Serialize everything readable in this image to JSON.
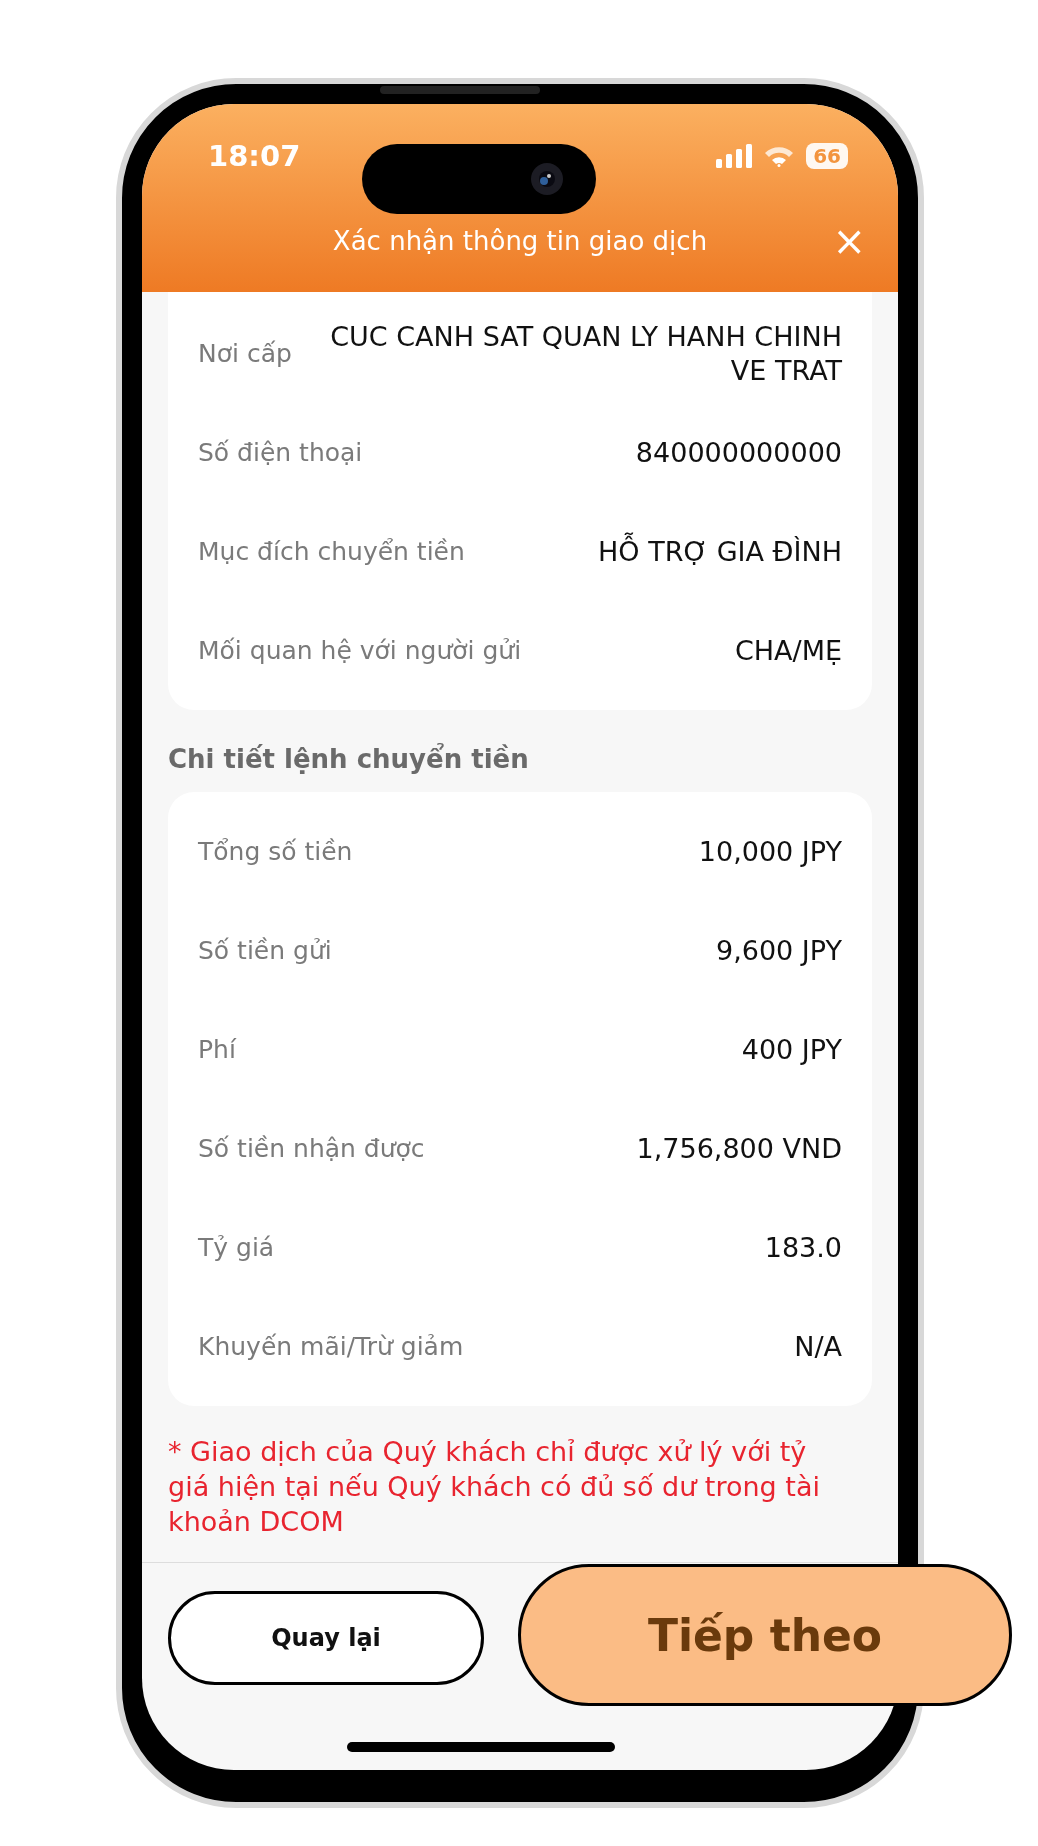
{
  "status_bar": {
    "time": "18:07",
    "battery": "66"
  },
  "header": {
    "title": "Xác nhận thông tin giao dịch",
    "close": "×"
  },
  "recipient_card": {
    "rows": [
      {
        "label": "Nơi cấp",
        "value": "CUC CANH SAT QUAN LY HANH CHINH VE TRAT"
      },
      {
        "label": "Số điện thoại",
        "value": "840000000000"
      },
      {
        "label": "Mục đích chuyển tiền",
        "value": "HỖ TRỢ GIA ĐÌNH"
      },
      {
        "label": "Mối quan hệ với người gửi",
        "value": "CHA/MẸ"
      }
    ]
  },
  "order_section": {
    "title": "Chi tiết lệnh chuyển tiền",
    "rows": [
      {
        "label": "Tổng số tiền",
        "value": "10,000 JPY"
      },
      {
        "label": "Số tiền gửi",
        "value": "9,600 JPY"
      },
      {
        "label": "Phí",
        "value": "400 JPY"
      },
      {
        "label": "Số tiền nhận được",
        "value": "1,756,800 VND"
      },
      {
        "label": "Tỷ giá",
        "value": "183.0"
      },
      {
        "label": "Khuyến mãi/Trừ giảm",
        "value": "N/A"
      }
    ]
  },
  "note": "* Giao dịch của Quý khách chỉ được xử lý với tỷ giá hiện tại nếu Quý khách có đủ số dư trong tài khoản DCOM",
  "buttons": [
    {
      "label": "Quay lại",
      "kind": "secondary"
    },
    {
      "label": "Tiếp theo",
      "kind": "primary"
    }
  ]
}
